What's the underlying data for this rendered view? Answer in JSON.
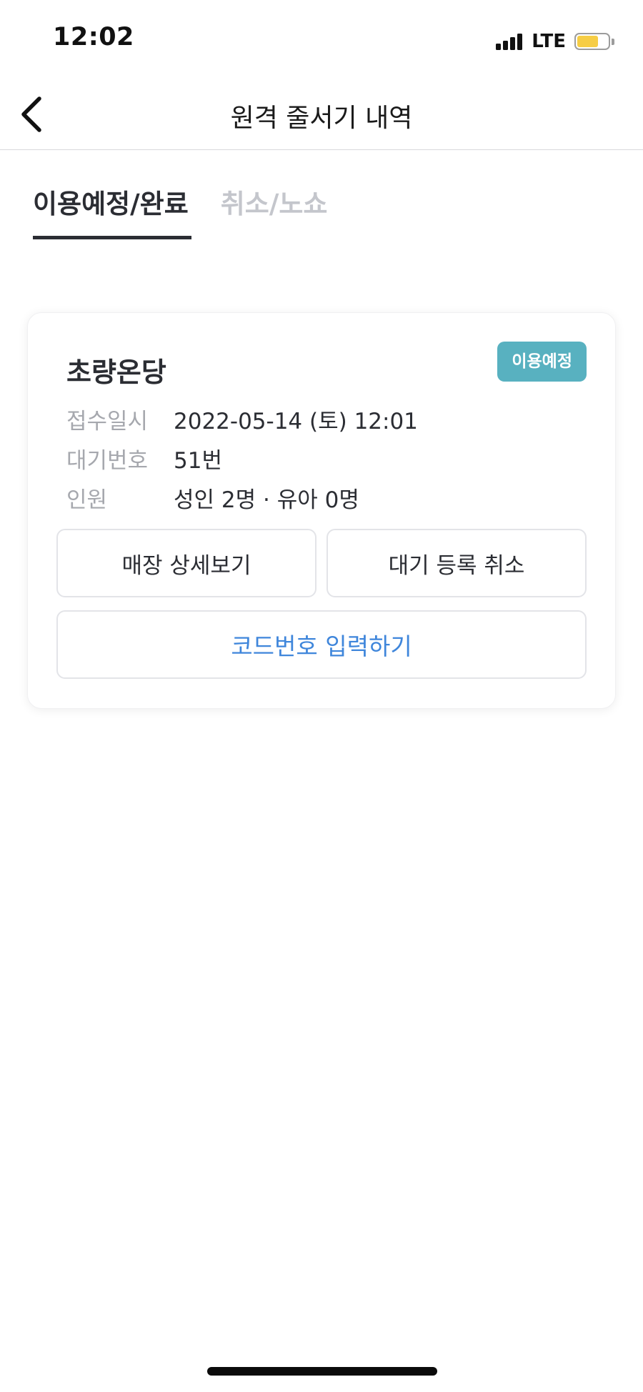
{
  "status_bar": {
    "time": "12:02",
    "network": "LTE",
    "signal_bars": 4,
    "battery_level": 0.7,
    "battery_color": "#f6cd45"
  },
  "nav": {
    "title": "원격 줄서기 내역",
    "back_icon": "chevron-left-icon"
  },
  "tabs": [
    {
      "label": "이용예정/완료",
      "active": true
    },
    {
      "label": "취소/노쇼",
      "active": false
    }
  ],
  "reservation": {
    "store_name": "초량온당",
    "status": "이용예정",
    "status_color": "#58b1c0",
    "details": [
      {
        "label": "접수일시",
        "value": "2022-05-14 (토) 12:01"
      },
      {
        "label": "대기번호",
        "value": "51번"
      },
      {
        "label": "인원",
        "value": "성인 2명 · 유아 0명"
      }
    ],
    "buttons": {
      "store_detail": "매장 상세보기",
      "cancel_waiting": "대기 등록 취소",
      "enter_code": "코드번호 입력하기"
    },
    "accent_color": "#3f86db"
  }
}
